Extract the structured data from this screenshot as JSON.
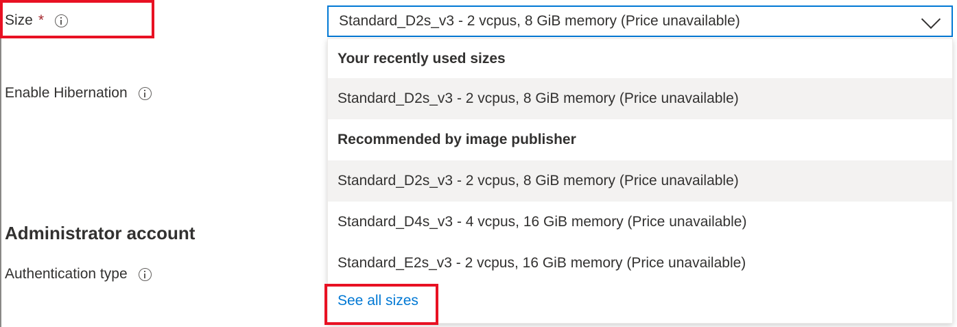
{
  "form": {
    "size_label": "Size",
    "required_marker": "*",
    "hibernation_label": "Enable Hibernation",
    "admin_heading": "Administrator account",
    "auth_label": "Authentication type"
  },
  "size_select": {
    "value": "Standard_D2s_v3 - 2 vcpus, 8 GiB memory (Price unavailable)"
  },
  "dropdown": {
    "recent_header": "Your recently used sizes",
    "recent_option": "Standard_D2s_v3 - 2 vcpus, 8 GiB memory (Price unavailable)",
    "recommended_header": "Recommended by image publisher",
    "recommended_options": [
      "Standard_D2s_v3 - 2 vcpus, 8 GiB memory (Price unavailable)",
      "Standard_D4s_v3 - 4 vcpus, 16 GiB memory (Price unavailable)",
      "Standard_E2s_v3 - 2 vcpus, 16 GiB memory (Price unavailable)"
    ],
    "see_all": "See all sizes"
  },
  "colors": {
    "accent": "#0078d4",
    "required": "#a4262c",
    "highlight": "#e81123",
    "selected_bg": "#f3f2f1"
  }
}
